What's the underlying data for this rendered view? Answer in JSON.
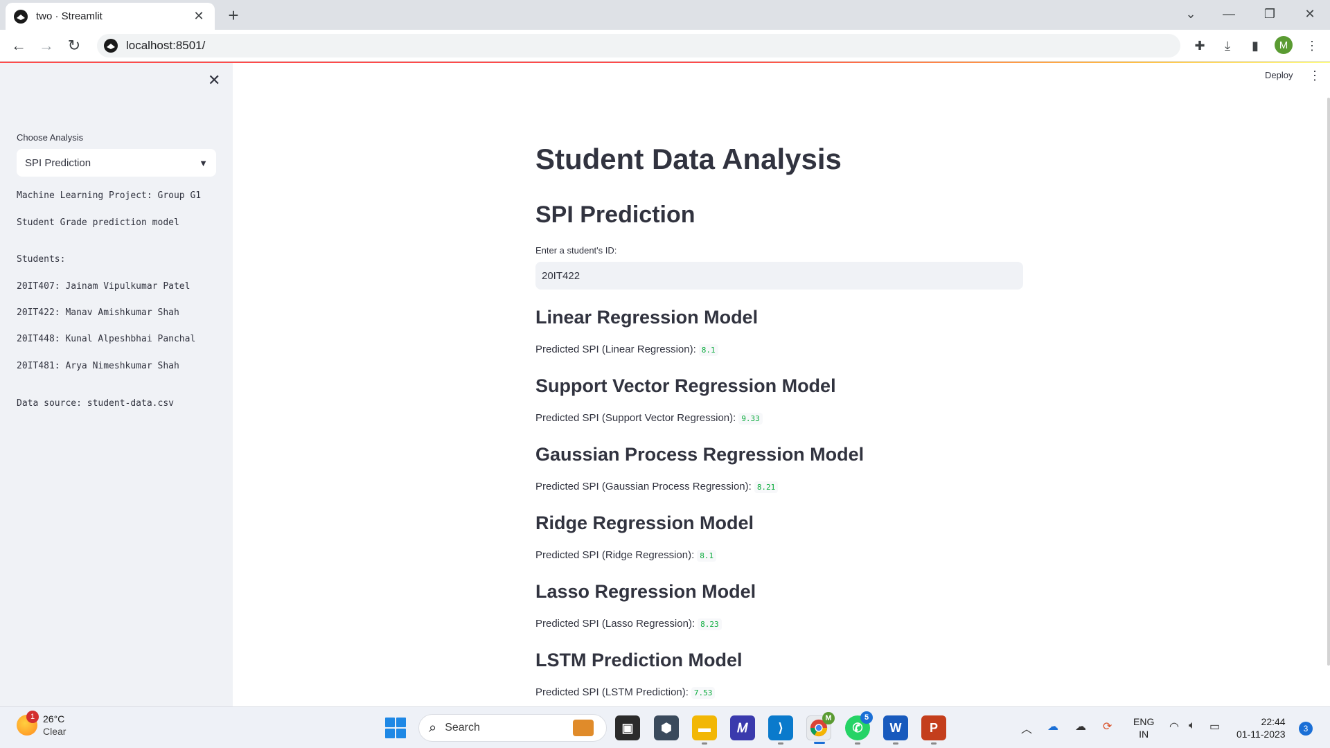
{
  "browser": {
    "tab_title": "two · Streamlit",
    "url": "localhost:8501/",
    "profile_initial": "M"
  },
  "app": {
    "deploy_label": "Deploy"
  },
  "sidebar": {
    "choose_label": "Choose Analysis",
    "selected_analysis": "SPI Prediction",
    "project_line": "Machine Learning Project: Group G1",
    "model_line": "Student Grade prediction model",
    "students_heading": "Students:",
    "students": [
      "20IT407: Jainam Vipulkumar Patel",
      "20IT422: Manav Amishkumar Shah",
      "20IT448: Kunal Alpeshbhai Panchal",
      "20IT481: Arya Nimeshkumar Shah"
    ],
    "data_source": "Data source: student-data.csv"
  },
  "main": {
    "title": "Student Data Analysis",
    "subtitle": "SPI Prediction",
    "input_label": "Enter a student's ID:",
    "input_value": "20IT422",
    "models": [
      {
        "heading": "Linear Regression Model",
        "label": "Predicted SPI (Linear Regression):",
        "value": "8.1"
      },
      {
        "heading": "Support Vector Regression Model",
        "label": "Predicted SPI (Support Vector Regression):",
        "value": "9.33"
      },
      {
        "heading": "Gaussian Process Regression Model",
        "label": "Predicted SPI (Gaussian Process Regression):",
        "value": "8.21"
      },
      {
        "heading": "Ridge Regression Model",
        "label": "Predicted SPI (Ridge Regression):",
        "value": "8.1"
      },
      {
        "heading": "Lasso Regression Model",
        "label": "Predicted SPI (Lasso Regression):",
        "value": "8.23"
      },
      {
        "heading": "LSTM Prediction Model",
        "label": "Predicted SPI (LSTM Prediction):",
        "value": "7.53"
      }
    ]
  },
  "taskbar": {
    "weather_temp": "26°C",
    "weather_cond": "Clear",
    "weather_badge": "1",
    "search_label": "Search",
    "chrome_badge": "M",
    "whatsapp_badge": "5",
    "lang_top": "ENG",
    "lang_bottom": "IN",
    "time": "22:44",
    "date": "01-11-2023",
    "notification_count": "3"
  },
  "colors": {
    "accent": "#ff4b4b",
    "sidebar_bg": "#f0f2f6",
    "code_value": "#09ab3b"
  }
}
